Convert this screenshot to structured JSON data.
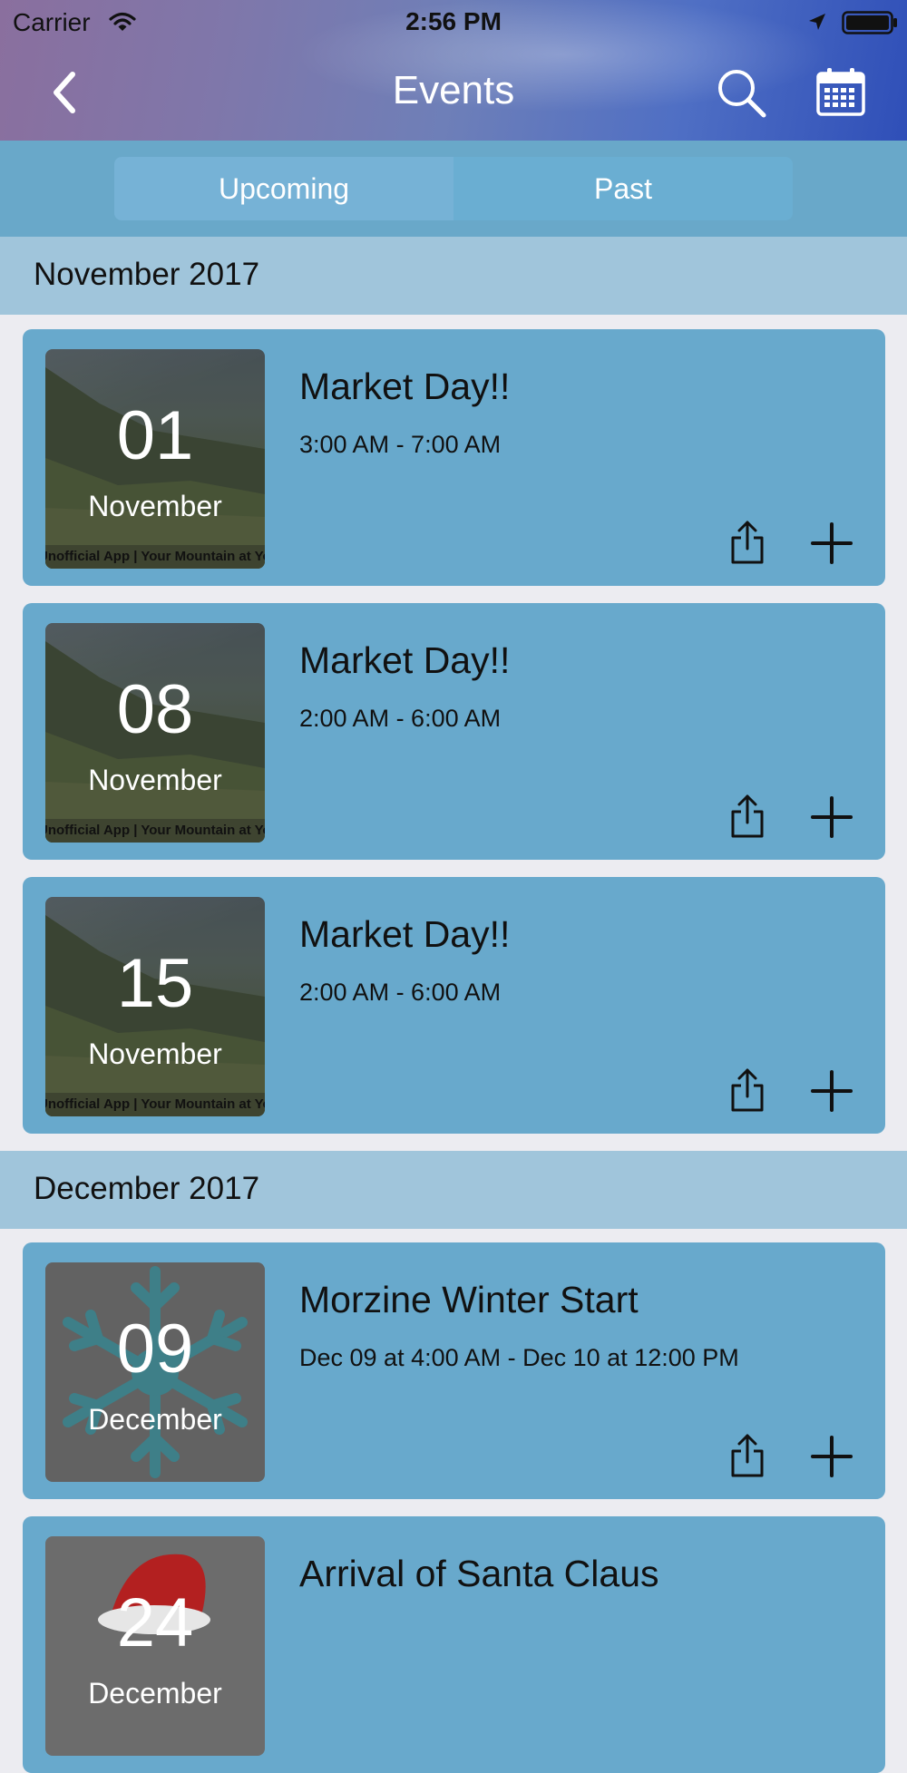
{
  "status_bar": {
    "carrier": "Carrier",
    "time": "2:56 PM"
  },
  "nav": {
    "title": "Events"
  },
  "tabs": [
    {
      "label": "Upcoming",
      "active": true
    },
    {
      "label": "Past",
      "active": false
    }
  ],
  "sections": [
    {
      "title": "November 2017",
      "events": [
        {
          "day": "01",
          "month": "November",
          "caption": "Unofficial App | Your Mountain at Your Fingertips",
          "title": "Market Day!!",
          "time": "3:00 AM - 7:00 AM"
        },
        {
          "day": "08",
          "month": "November",
          "caption": "Unofficial App | Your Mountain at Your Fingertips",
          "title": "Market Day!!",
          "time": "2:00 AM - 6:00 AM"
        },
        {
          "day": "15",
          "month": "November",
          "caption": "Unofficial App | Your Mountain at Your Fingertips",
          "title": "Market Day!!",
          "time": "2:00 AM - 6:00 AM"
        }
      ]
    },
    {
      "title": "December 2017",
      "events": [
        {
          "day": "09",
          "month": "December",
          "title": "Morzine Winter Start",
          "time": "Dec 09 at 4:00 AM - Dec 10 at 12:00 PM"
        },
        {
          "day": "24",
          "month": "December",
          "title": "Arrival of Santa Claus",
          "time": ""
        }
      ]
    }
  ],
  "colors": {
    "card": "#68a9cc",
    "section_header": "#a0c5db",
    "segment_bar": "#69a8c9",
    "background": "#ececf1"
  }
}
